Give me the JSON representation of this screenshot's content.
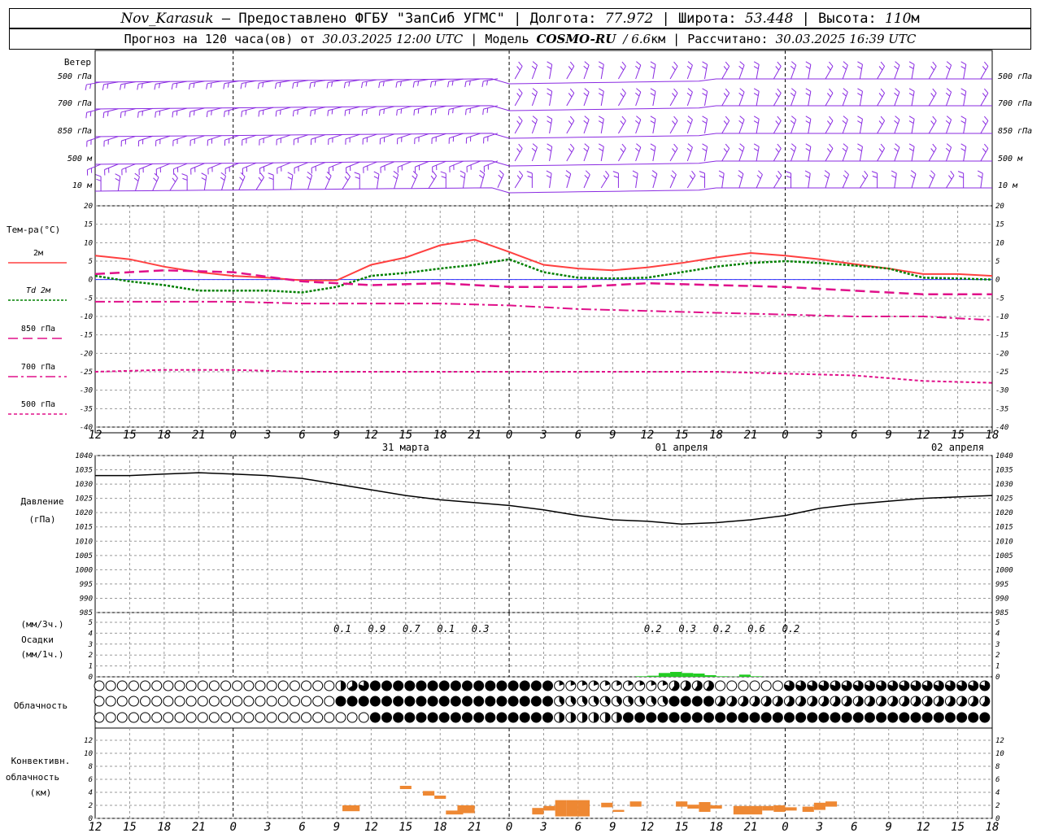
{
  "header": {
    "station": "Nov_Karasuk",
    "provider": "– Предоставлено ФГБУ \"ЗапСиб УГМС\"",
    "lon_label": "Долгота:",
    "lon": "77.972",
    "lat_label": "Широта:",
    "lat": "53.448",
    "alt_label": "Высота:",
    "alt": "110",
    "alt_unit": "м",
    "forecast_label": "Прогноз на 120 часа(ов) от",
    "forecast_start": "30.03.2025 12:00 UTC",
    "model_label": "Модель",
    "model": "COSMO-RU",
    "model_res": "/ 6.6",
    "model_res_unit": "км",
    "calc_label": "Рассчитано:",
    "calc_time": "30.03.2025 16:39 UTC"
  },
  "wind_panel": {
    "title": "Ветер",
    "levels": [
      "500 гПа",
      "700 гПа",
      "850 гПа",
      "500 м",
      "10 м"
    ]
  },
  "temp_panel": {
    "title": "Тем-ра(°С)",
    "legend": [
      {
        "label": "2м",
        "color": "#ff4040",
        "dash": ""
      },
      {
        "label": "Td 2м",
        "color": "#008000",
        "dash": "3,2"
      },
      {
        "label": "850 гПа",
        "color": "#e0108a",
        "dash": "12,6"
      },
      {
        "label": "700 гПа",
        "color": "#e0108a",
        "dash": "12,4,3,4"
      },
      {
        "label": "500 гПа",
        "color": "#e0108a",
        "dash": "4,3"
      }
    ]
  },
  "pressure_panel": {
    "title": "Давление",
    "unit": "(гПа)"
  },
  "precip_panel": {
    "unit_top": "(мм/3ч.)",
    "title": "Осадки",
    "unit_bottom": "(мм/1ч.)",
    "totals": [
      {
        "t": 21,
        "v": "0.1"
      },
      {
        "t": 24,
        "v": "0.9"
      },
      {
        "t": 27,
        "v": "0.7"
      },
      {
        "t": 30,
        "v": "0.1"
      },
      {
        "t": 33,
        "v": "0.3"
      },
      {
        "t": 48,
        "v": "0.2"
      },
      {
        "t": 51,
        "v": "0.3"
      },
      {
        "t": 54,
        "v": "0.2"
      },
      {
        "t": 57,
        "v": "0.6"
      },
      {
        "t": 60,
        "v": "0.2"
      }
    ]
  },
  "cloud_panel": {
    "title": "Облачность"
  },
  "conv_panel": {
    "title_1": "Конвективн.",
    "title_2": "облачность",
    "unit": "(км)"
  },
  "time_axis": {
    "hour_labels": [
      "12",
      "15",
      "18",
      "21",
      "0",
      "3",
      "6",
      "9",
      "12",
      "15",
      "18",
      "21",
      "0",
      "3",
      "6",
      "9",
      "12",
      "15",
      "18",
      "21",
      "0",
      "3",
      "6",
      "9",
      "12",
      "15",
      "18"
    ],
    "day_labels": [
      {
        "t": 27,
        "label": "31 марта"
      },
      {
        "t": 51,
        "label": "01 апреля"
      },
      {
        "t": 75,
        "label": "02 апреля"
      }
    ]
  },
  "chart_data": [
    {
      "type": "line",
      "title": "Тем-ра(°С)",
      "x_unit": "hours since 30.03.2025 12:00 UTC",
      "ylim": [
        -40,
        20
      ],
      "yticks": [
        20,
        15,
        10,
        5,
        0,
        -5,
        -10,
        -15,
        -20,
        -25,
        -30,
        -35,
        -40
      ],
      "series": [
        {
          "name": "2м",
          "x": [
            0,
            3,
            6,
            9,
            12,
            15,
            18,
            21,
            24,
            27,
            30,
            33,
            36,
            39,
            42,
            45,
            48,
            51,
            54,
            57,
            60,
            63,
            66,
            69,
            72,
            75,
            78
          ],
          "y": [
            6.5,
            5.5,
            3.5,
            2,
            1,
            0.5,
            -0.2,
            -0.2,
            4,
            6,
            9.3,
            10.8,
            7.5,
            4,
            3,
            2.5,
            3.3,
            4.5,
            6,
            7.2,
            6.5,
            5.5,
            4.2,
            3,
            1.5,
            1.5,
            1
          ]
        },
        {
          "name": "Td 2м",
          "x": [
            0,
            3,
            6,
            9,
            12,
            15,
            18,
            21,
            24,
            27,
            30,
            33,
            36,
            39,
            42,
            45,
            48,
            51,
            54,
            57,
            60,
            63,
            66,
            69,
            72,
            75,
            78
          ],
          "y": [
            1,
            -0.5,
            -1.5,
            -3,
            -3,
            -3,
            -3.5,
            -2,
            1,
            1.8,
            3,
            4,
            5.5,
            2,
            0.5,
            0.3,
            0.5,
            2,
            3.5,
            4.5,
            5,
            4.5,
            3.8,
            3,
            0.5,
            0.3,
            0
          ]
        },
        {
          "name": "850 гПа",
          "x": [
            0,
            6,
            12,
            18,
            24,
            30,
            36,
            42,
            48,
            54,
            60,
            66,
            72,
            78
          ],
          "y": [
            1.5,
            2.5,
            2,
            -0.5,
            -1.5,
            -1,
            -2,
            -2,
            -1,
            -1.5,
            -2,
            -3,
            -4,
            -4
          ]
        },
        {
          "name": "700 гПа",
          "x": [
            0,
            6,
            12,
            18,
            24,
            30,
            36,
            42,
            48,
            54,
            60,
            66,
            72,
            78
          ],
          "y": [
            -6,
            -6,
            -6,
            -6.5,
            -6.5,
            -6.5,
            -7,
            -8,
            -8.5,
            -9,
            -9.5,
            -10,
            -10,
            -11
          ]
        },
        {
          "name": "500 гПа",
          "x": [
            0,
            6,
            12,
            18,
            24,
            30,
            36,
            42,
            48,
            54,
            60,
            66,
            72,
            78
          ],
          "y": [
            -25,
            -24.5,
            -24.5,
            -25,
            -25,
            -25,
            -25,
            -25,
            -25,
            -25,
            -25.5,
            -26,
            -27.5,
            -28
          ]
        }
      ]
    },
    {
      "type": "line",
      "title": "Давление",
      "ylabel": "(гПа)",
      "x_unit": "hours since 30.03.2025 12:00 UTC",
      "ylim": [
        985,
        1040
      ],
      "yticks": [
        1040,
        1035,
        1030,
        1025,
        1020,
        1015,
        1010,
        1005,
        1000,
        995,
        990,
        985
      ],
      "series": [
        {
          "name": "Давление",
          "x": [
            0,
            3,
            6,
            9,
            12,
            15,
            18,
            21,
            24,
            27,
            30,
            33,
            36,
            39,
            42,
            45,
            48,
            51,
            54,
            57,
            60,
            63,
            66,
            69,
            72,
            75,
            78
          ],
          "y": [
            1033,
            1033,
            1033.5,
            1034,
            1033.5,
            1033,
            1032,
            1030,
            1028,
            1026,
            1024.5,
            1023.5,
            1022.5,
            1021,
            1019,
            1017.5,
            1017,
            1016,
            1016.5,
            1017.5,
            1019,
            1021.5,
            1023,
            1024,
            1025,
            1025.5,
            1026
          ]
        }
      ]
    },
    {
      "type": "bar",
      "title": "Осадки",
      "ylabel": "(мм/1ч.)",
      "x_unit": "hours since 30.03.2025 12:00 UTC",
      "ylim": [
        0,
        5
      ],
      "yticks": [
        5,
        4,
        3,
        2,
        1,
        0
      ],
      "x": [
        24,
        25,
        26,
        27,
        28,
        29,
        30,
        31,
        32,
        33,
        34,
        35,
        36,
        37,
        38,
        39,
        40,
        41,
        42,
        43,
        44,
        45,
        46,
        47,
        48,
        49,
        50,
        51,
        52,
        53,
        54,
        55,
        56,
        57,
        58,
        59,
        60,
        61,
        62,
        63,
        64,
        65,
        66,
        67,
        68,
        69,
        70,
        71,
        72,
        73,
        74,
        75,
        76,
        77,
        78
      ],
      "values": [
        0,
        0,
        0,
        0,
        0,
        0,
        0,
        0,
        0,
        0,
        0,
        0,
        0,
        0,
        0,
        0,
        0,
        0,
        0,
        0,
        0,
        0,
        0,
        0.05,
        0.1,
        0.35,
        0.45,
        0.35,
        0.3,
        0.15,
        0.05,
        0.02,
        0.2,
        0.05,
        0,
        0,
        0,
        0,
        0,
        0,
        0,
        0,
        0,
        0,
        0,
        0,
        0,
        0,
        0,
        0,
        0,
        0,
        0,
        0,
        0
      ]
    },
    {
      "type": "bar",
      "title": "Конвективн. облачность",
      "ylabel": "(км)",
      "x_unit": "hours since 30.03.2025 12:00 UTC",
      "ylim": [
        0,
        13
      ],
      "yticks": [
        12,
        10,
        8,
        6,
        4,
        2,
        0
      ],
      "bars": [
        {
          "x0": 21.5,
          "x1": 23.0,
          "base": 1.1,
          "top": 2.0
        },
        {
          "x0": 26.5,
          "x1": 27.5,
          "base": 4.5,
          "top": 5.0
        },
        {
          "x0": 28.5,
          "x1": 29.5,
          "base": 3.5,
          "top": 4.2
        },
        {
          "x0": 29.5,
          "x1": 30.5,
          "base": 3.0,
          "top": 3.5
        },
        {
          "x0": 30.5,
          "x1": 32.0,
          "base": 0.6,
          "top": 1.2
        },
        {
          "x0": 31.5,
          "x1": 33.0,
          "base": 0.8,
          "top": 2.0
        },
        {
          "x0": 38.0,
          "x1": 39.0,
          "base": 0.6,
          "top": 1.6
        },
        {
          "x0": 39.0,
          "x1": 40.0,
          "base": 1.2,
          "top": 1.9
        },
        {
          "x0": 40.0,
          "x1": 41.0,
          "base": 0.3,
          "top": 2.8
        },
        {
          "x0": 41.0,
          "x1": 42.0,
          "base": 0.3,
          "top": 2.8
        },
        {
          "x0": 42.0,
          "x1": 43.0,
          "base": 0.3,
          "top": 2.8
        },
        {
          "x0": 44.0,
          "x1": 45.0,
          "base": 1.7,
          "top": 2.4
        },
        {
          "x0": 45.0,
          "x1": 46.0,
          "base": 1.0,
          "top": 1.3
        },
        {
          "x0": 46.5,
          "x1": 47.5,
          "base": 1.8,
          "top": 2.6
        },
        {
          "x0": 50.5,
          "x1": 51.5,
          "base": 1.8,
          "top": 2.6
        },
        {
          "x0": 51.5,
          "x1": 52.5,
          "base": 1.5,
          "top": 2.1
        },
        {
          "x0": 52.5,
          "x1": 53.5,
          "base": 1.0,
          "top": 2.5
        },
        {
          "x0": 53.5,
          "x1": 54.5,
          "base": 1.5,
          "top": 2.0
        },
        {
          "x0": 55.5,
          "x1": 57.0,
          "base": 0.6,
          "top": 1.9
        },
        {
          "x0": 57.0,
          "x1": 58.0,
          "base": 0.6,
          "top": 1.9
        },
        {
          "x0": 58.0,
          "x1": 59.0,
          "base": 1.2,
          "top": 1.9
        },
        {
          "x0": 59.0,
          "x1": 60.0,
          "base": 1.0,
          "top": 2.0
        },
        {
          "x0": 60.0,
          "x1": 61.0,
          "base": 1.2,
          "top": 1.7
        },
        {
          "x0": 61.5,
          "x1": 62.5,
          "base": 1.0,
          "top": 1.8
        },
        {
          "x0": 62.5,
          "x1": 63.5,
          "base": 1.3,
          "top": 2.4
        },
        {
          "x0": 63.5,
          "x1": 64.5,
          "base": 1.8,
          "top": 2.6
        }
      ]
    }
  ]
}
